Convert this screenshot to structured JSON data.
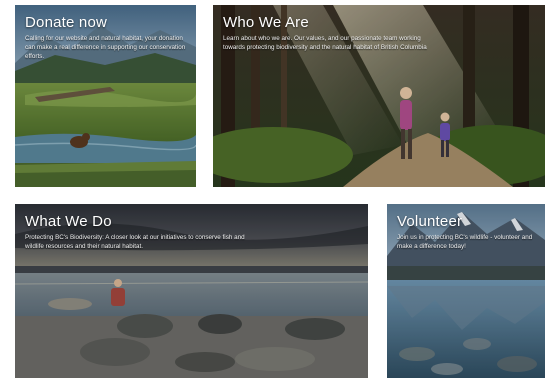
{
  "tiles": [
    {
      "title": "Donate now",
      "description": "Calling for our website and natural habitat, your donation can make a real difference in supporting our conservation efforts."
    },
    {
      "title": "Who We Are",
      "description": "Learn about who we are. Our values, and our passionate team working towards protecting biodiversity and the natural habitat of British Columbia"
    },
    {
      "title": "What We Do",
      "description": "Protecting BC's Biodiversity: A closer look at our initiatives to conserve fish and wildlife resources and their natural habitat."
    },
    {
      "title": "Volunteer",
      "description": "Join us in protecting BC's wildlife - volunteer and make a difference today!"
    }
  ]
}
